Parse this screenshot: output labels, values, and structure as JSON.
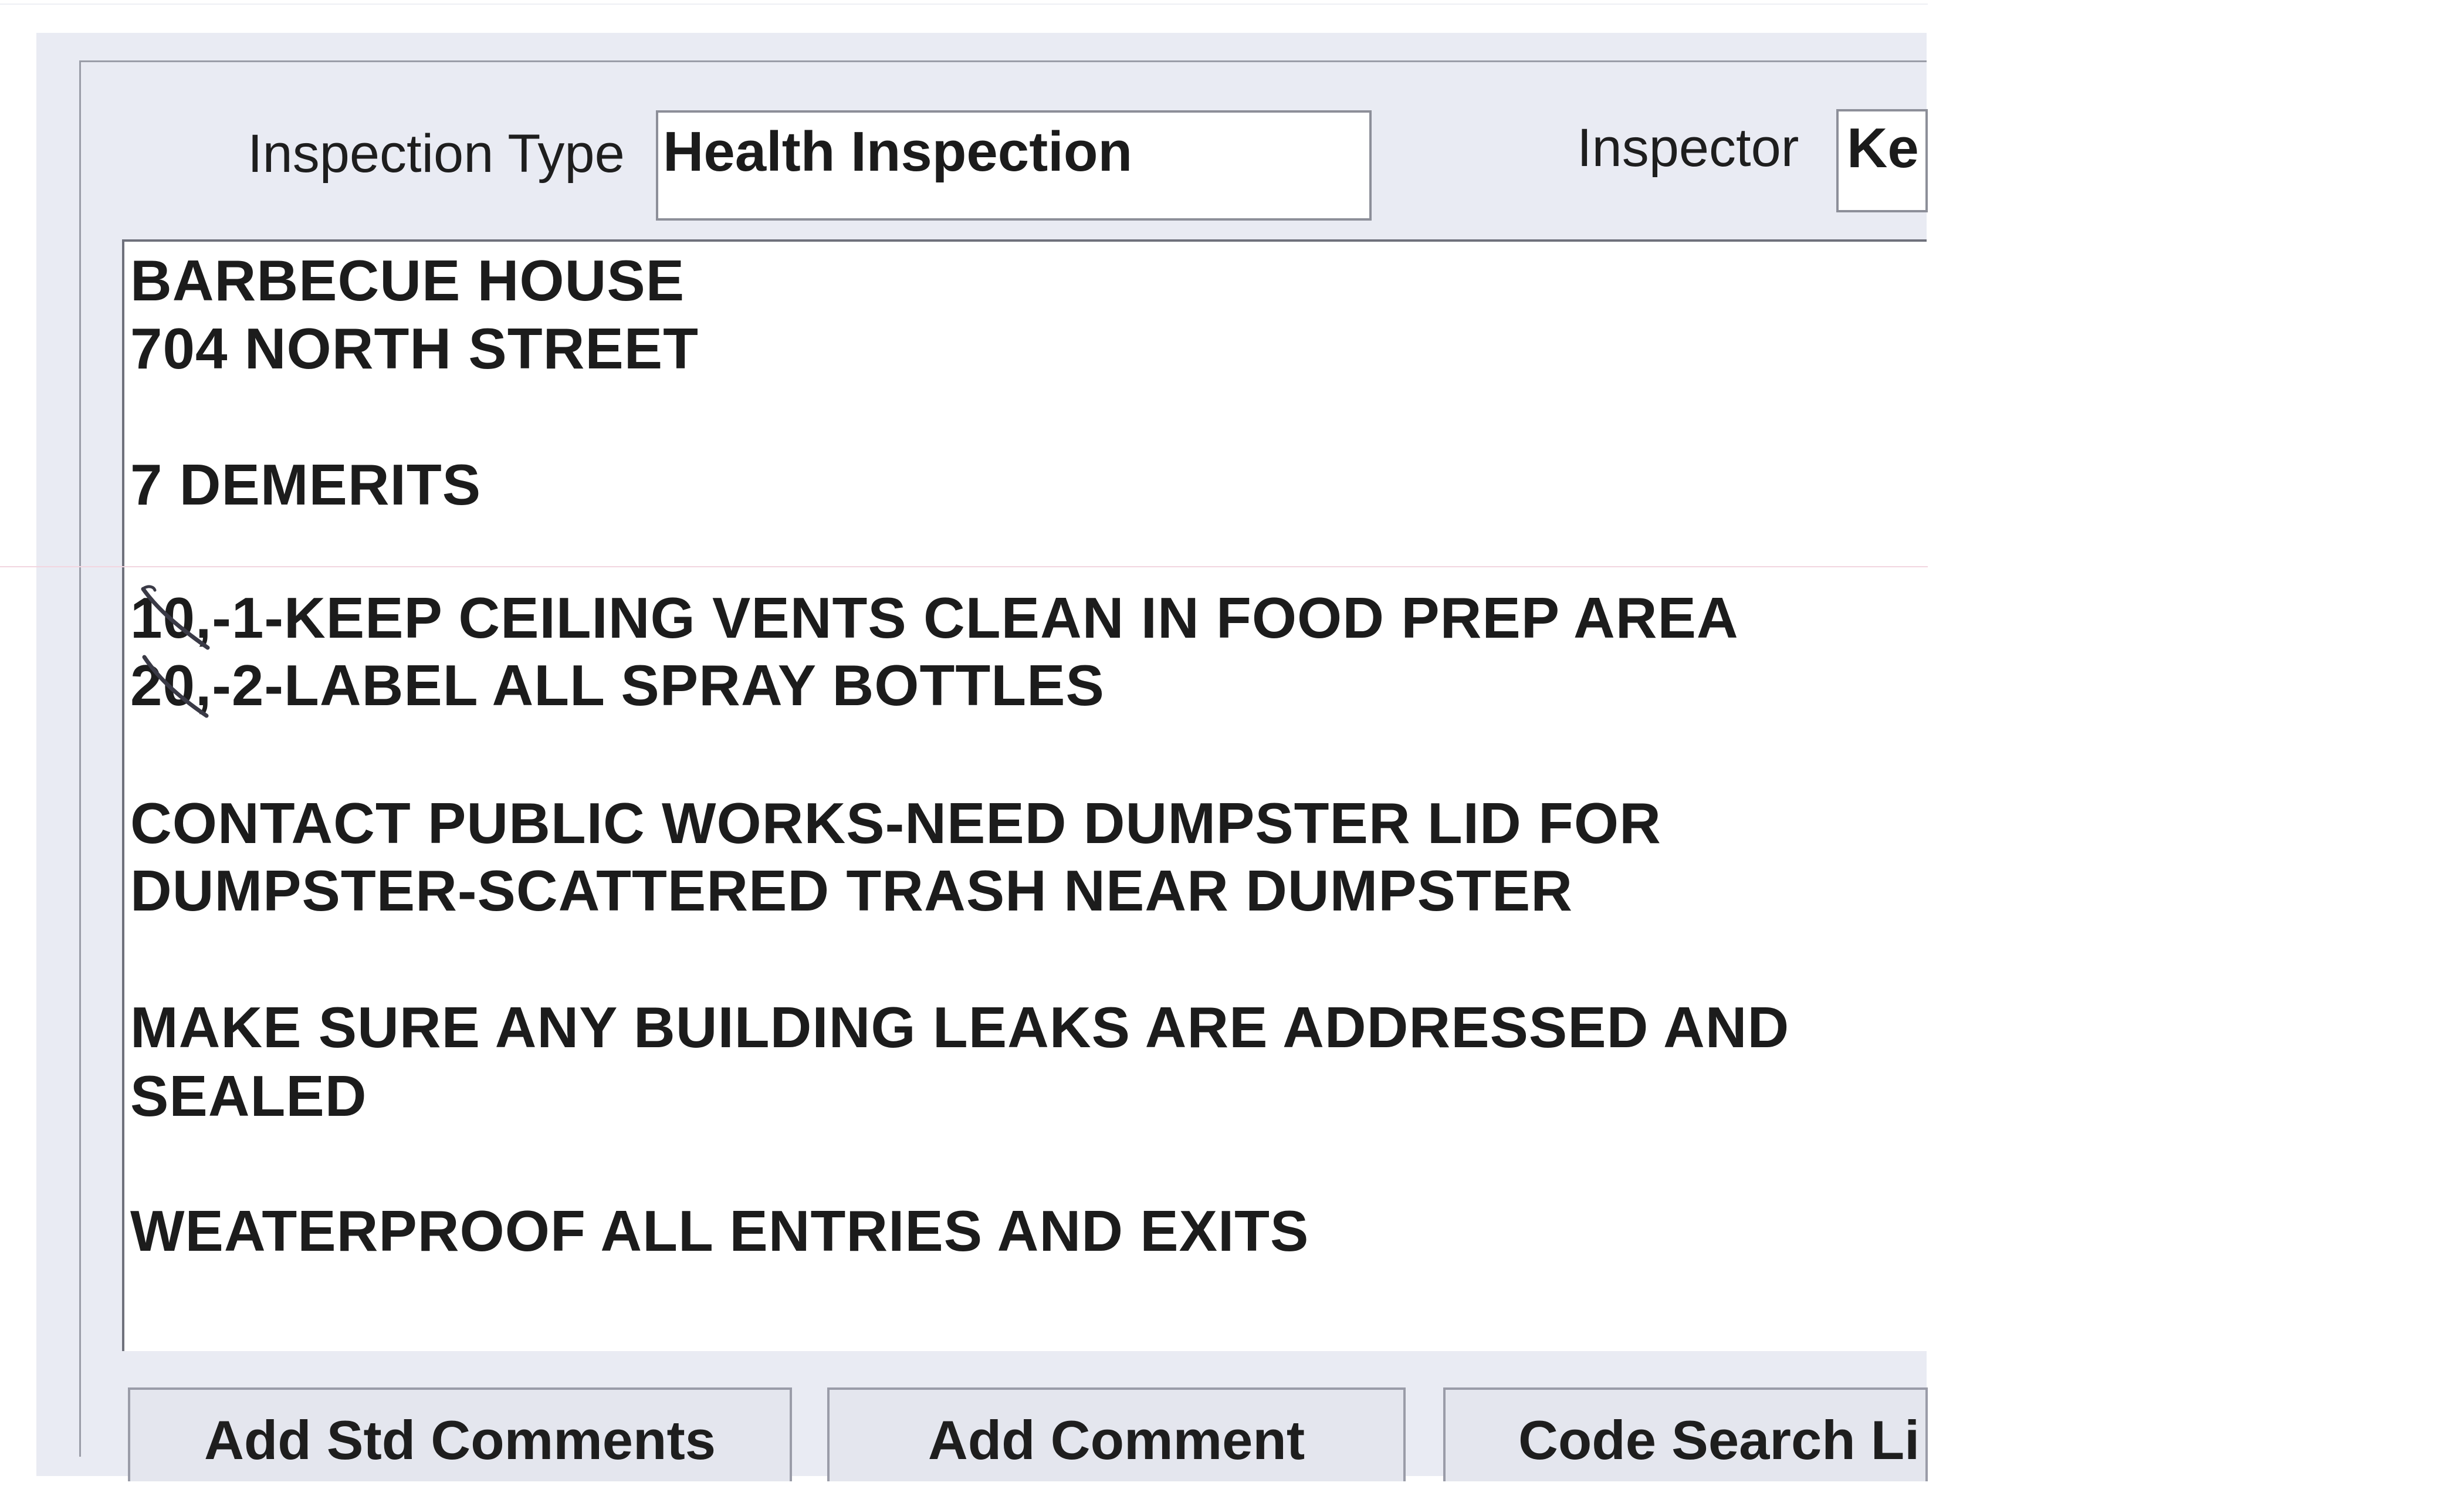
{
  "header": {
    "inspection_type_label": "Inspection Type",
    "inspection_type_value": "Health Inspection",
    "inspector_label": "Inspector",
    "inspector_value": "Ke"
  },
  "comments": {
    "lines": [
      "BARBECUE HOUSE",
      "704 NORTH STREET",
      "7 DEMERITS",
      "10,-1-KEEP CEILING VENTS CLEAN IN FOOD PREP AREA",
      "20,-2-LABEL ALL SPRAY BOTTLES",
      "CONTACT PUBLIC WORKS-NEED DUMPSTER LID FOR",
      "DUMPSTER-SCATTERED TRASH NEAR DUMPSTER",
      "MAKE SURE ANY BUILDING LEAKS ARE ADDRESSED AND",
      "SEALED",
      "WEATERPROOF ALL ENTRIES AND EXITS"
    ]
  },
  "buttons": {
    "add_std_comments": "Add Std Comments",
    "add_comment": "Add Comment",
    "code_search": "Code Search Li"
  },
  "colors": {
    "window_background": "#e9ebf3",
    "text_area_background": "#ffffff",
    "handwritten_mark": "#3a3a46"
  }
}
